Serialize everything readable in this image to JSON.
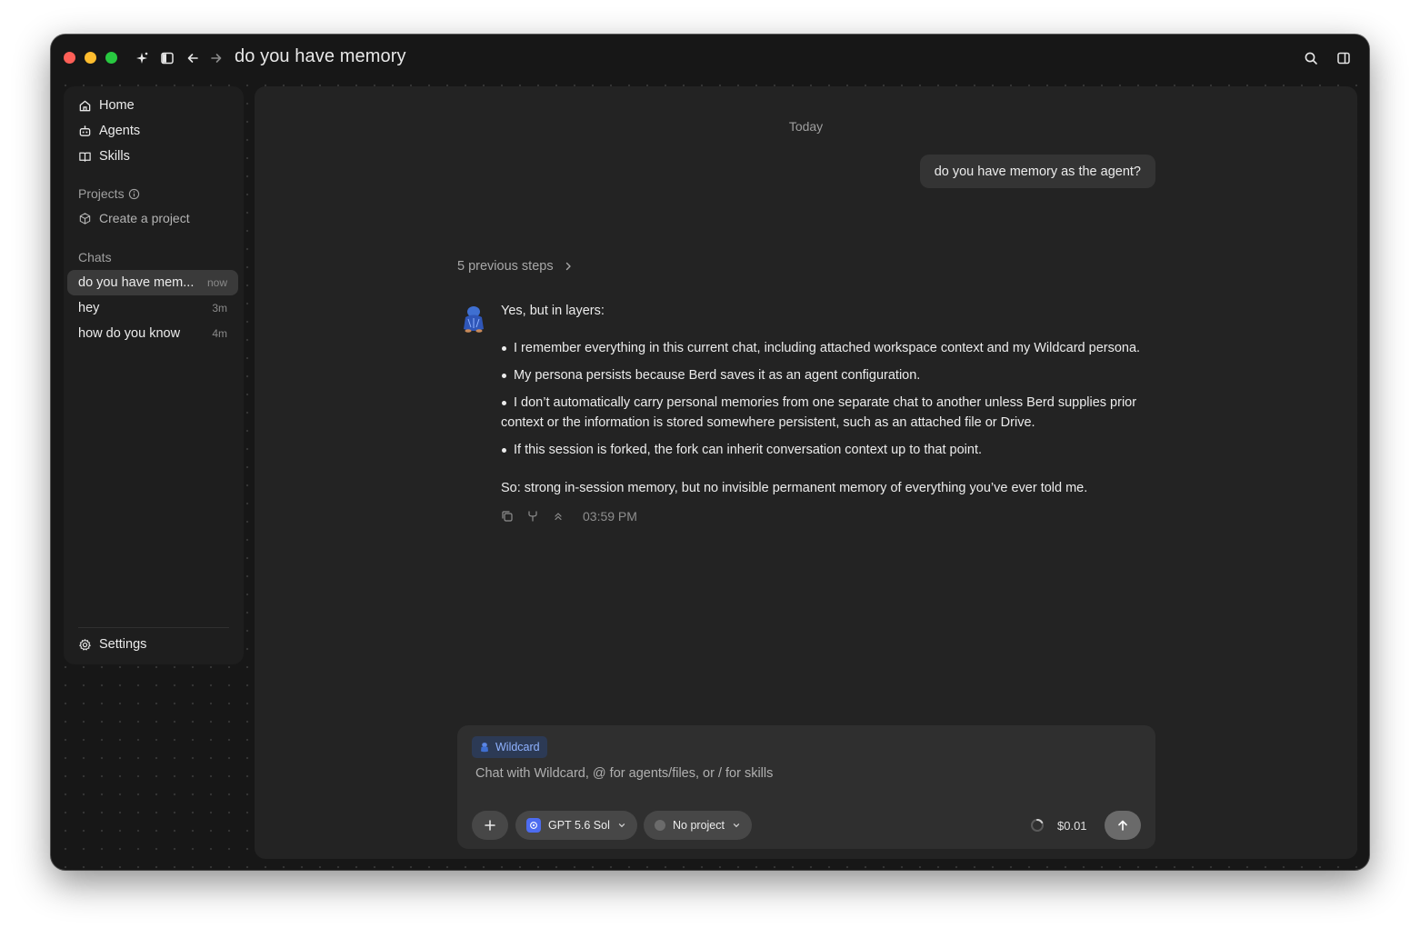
{
  "window": {
    "title": "do you have memory"
  },
  "titlebar": {
    "icons": [
      "sparkle-icon",
      "sidebar-toggle-icon",
      "back-arrow-icon",
      "forward-arrow-icon",
      "search-icon",
      "panel-right-icon"
    ]
  },
  "sidebar": {
    "nav": [
      {
        "label": "Home",
        "icon": "home-icon"
      },
      {
        "label": "Agents",
        "icon": "robot-icon"
      },
      {
        "label": "Skills",
        "icon": "book-icon"
      }
    ],
    "projects_label": "Projects",
    "create_project_label": "Create a project",
    "chats_label": "Chats",
    "chats": [
      {
        "title": "do you have mem...",
        "time": "now",
        "active": true
      },
      {
        "title": "hey",
        "time": "3m",
        "active": false
      },
      {
        "title": "how do you know",
        "time": "4m",
        "active": false
      }
    ],
    "settings_label": "Settings"
  },
  "conversation": {
    "date_separator": "Today",
    "user_message": "do you have memory as the agent?",
    "previous_steps": "5 previous steps",
    "assistant": {
      "intro": "Yes, but in layers:",
      "bullets": [
        "I remember everything in this current chat, including attached workspace context and my Wildcard persona.",
        "My persona persists because Berd saves it as an agent configuration.",
        "I don’t automatically carry personal memories from one separate chat to another unless Berd supplies prior context or the information is stored somewhere persistent, such as an attached file or Drive.",
        "If this session is forked, the fork can inherit conversation context up to that point."
      ],
      "summary": "So: strong in-session memory, but no invisible permanent memory of everything you’ve ever told me.",
      "timestamp": "03:59 PM"
    }
  },
  "composer": {
    "agent_chip": "Wildcard",
    "placeholder": "Chat with Wildcard, @ for agents/files, or / for skills",
    "value": "",
    "model": "GPT 5.6 Sol",
    "project": "No project",
    "cost": "$0.01"
  },
  "colors": {
    "window_bg": "#171717",
    "panel_bg": "#232323",
    "sidebar_bg": "#1e1e1e",
    "accent_blue": "#8fb2ff",
    "traffic_red": "#fe5f57",
    "traffic_yellow": "#febc2e",
    "traffic_green": "#28c840"
  }
}
